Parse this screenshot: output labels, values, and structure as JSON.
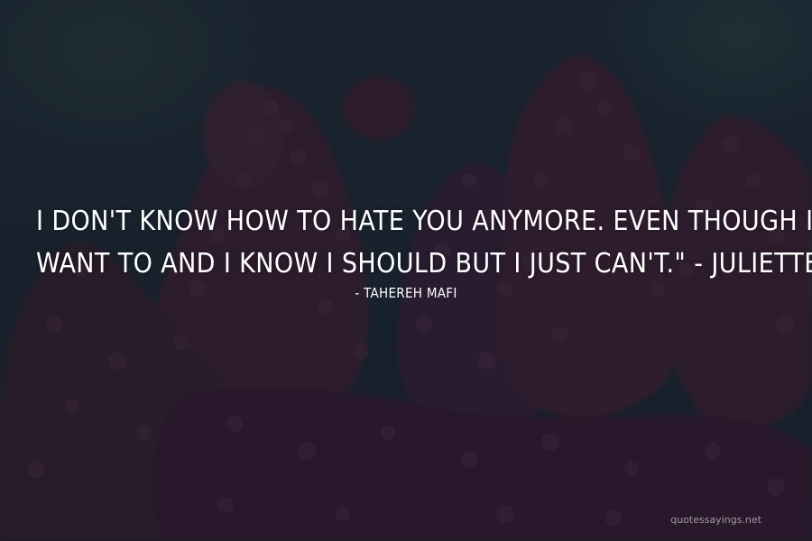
{
  "quote": {
    "lines": [
      "I DON'T KNOW HOW TO HATE YOU ANYMORE. EVEN THOUGH I",
      "WANT TO AND I KNOW I SHOULD BUT I JUST CAN'T.\" - JULIETTE"
    ]
  },
  "author": "- TAHEREH MAFI",
  "watermark": "quotessayings.net",
  "colors": {
    "text": "#ffffff",
    "sky": "#1e2b36",
    "blossom": "#3b2238",
    "blossom_light": "#4e2c47",
    "foliage": "#2c4a33"
  }
}
